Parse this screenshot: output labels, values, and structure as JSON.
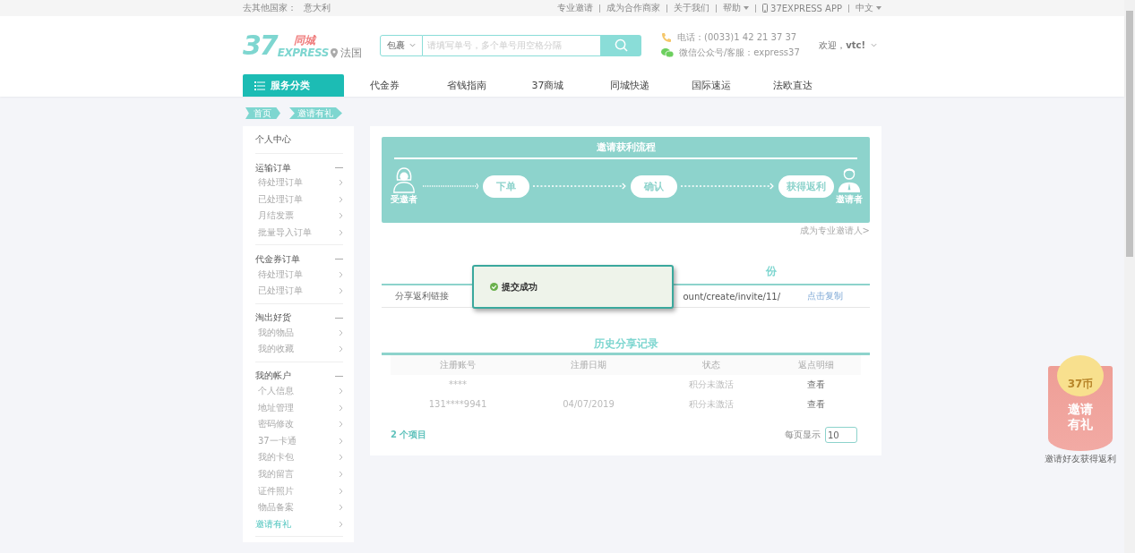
{
  "top_bar": {
    "country_label": "去其他国家：",
    "country": "意大利",
    "links": [
      {
        "label": "专业邀请",
        "kind": "link"
      },
      {
        "label": "成为合作商家",
        "kind": "link"
      },
      {
        "label": "关于我们",
        "kind": "link"
      },
      {
        "label": "帮助",
        "kind": "dropdown"
      },
      {
        "label": "37EXPRESS APP",
        "kind": "app"
      },
      {
        "label": "中文",
        "kind": "dropdown"
      }
    ]
  },
  "header": {
    "logo": {
      "number": "37",
      "brand": "同城",
      "express": "EXPRESS"
    },
    "location": "法国",
    "search": {
      "type": "包裹",
      "placeholder": "请填写单号，多个单号用空格分隔"
    },
    "contact": [
      {
        "kind": "phone",
        "text": "电话：(0033)1 42 21 37 37"
      },
      {
        "kind": "wechat",
        "text": "微信公众号/客服：express37"
      }
    ],
    "welcome": "欢迎，**vtc!**"
  },
  "nav": {
    "category": "服务分类",
    "items": [
      "代金券",
      "省钱指南",
      "37商城",
      "同城快递",
      "国际速运",
      "法欧直达"
    ]
  },
  "breadcrumb": [
    "首页",
    "邀请有礼"
  ],
  "sidebar": {
    "title": "个人中心",
    "groups": [
      {
        "title": "运输订单",
        "expanded": true,
        "items": [
          {
            "label": "待处理订单",
            "selected": false
          },
          {
            "label": "已处理订单",
            "selected": false
          },
          {
            "label": "月结发票",
            "selected": false
          },
          {
            "label": "批量导入订单",
            "selected": false
          }
        ]
      },
      {
        "title": "代金券订单",
        "expanded": true,
        "items": [
          {
            "label": "待处理订单",
            "selected": false
          },
          {
            "label": "已处理订单",
            "selected": false
          }
        ]
      },
      {
        "title": "淘出好货",
        "expanded": true,
        "items": [
          {
            "label": "我的物品",
            "selected": false
          },
          {
            "label": "我的收藏",
            "selected": false
          }
        ]
      },
      {
        "title": "我的帐户",
        "expanded": true,
        "items": [
          {
            "label": "个人信息",
            "selected": false
          },
          {
            "label": "地址管理",
            "selected": false
          },
          {
            "label": "密码修改",
            "selected": false
          },
          {
            "label": "37一卡通",
            "selected": false
          },
          {
            "label": "我的卡包",
            "selected": false
          },
          {
            "label": "我的留言",
            "selected": false
          },
          {
            "label": "证件照片",
            "selected": false
          },
          {
            "label": "物品备案",
            "selected": false
          },
          {
            "label": "邀请有礼",
            "selected": true
          }
        ]
      }
    ]
  },
  "process": {
    "title": "邀请获利流程",
    "start": "受邀者",
    "steps": [
      "下单",
      "确认",
      "获得返利"
    ],
    "end": "邀请者"
  },
  "pro_link": "成为专业邀请人>",
  "share": {
    "heading": "份",
    "label": "分享返利链接",
    "url": "ount/create/invite/11/",
    "copy": "点击复制"
  },
  "history": {
    "title": "历史分享记录",
    "columns": [
      "注册账号",
      "注册日期",
      "状态",
      "返点明细"
    ],
    "rows": [
      {
        "account": "****",
        "status": "积分未激活",
        "detail": "查看"
      },
      {
        "account": "131****9941",
        "date": "04/07/2019",
        "status": "积分未激活",
        "detail": "查看"
      }
    ],
    "count": "2 个项目",
    "per_page_label": "每页显示",
    "per_page": "10"
  },
  "toast": {
    "kind": "success",
    "text": "提交成功"
  },
  "promo": {
    "coin": "37币",
    "title_lines": [
      "邀请",
      "有礼"
    ],
    "caption": "邀请好友获得返利"
  }
}
